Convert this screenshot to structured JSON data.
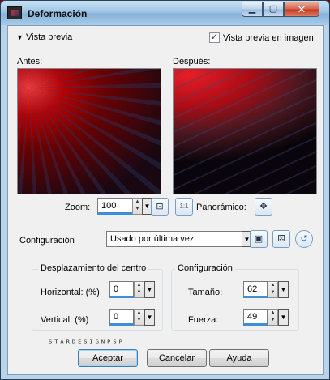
{
  "window": {
    "title": "Deformación",
    "controls": {
      "minimize": "▁",
      "maximize": "▢",
      "close": "✕"
    }
  },
  "preview_section": {
    "toggle_label": "Vista previa",
    "checkbox_label": "Vista previa en imagen",
    "checkbox_checked": true,
    "before_label": "Antes:",
    "after_label": "Después:"
  },
  "zoom": {
    "label": "Zoom:",
    "value": "100",
    "pan_label": "Panorámico:",
    "one_to_one": "1:1"
  },
  "configuracion_top": {
    "label": "Configuración",
    "selected_preset": "Usado por última vez"
  },
  "center_group": {
    "title": "Desplazamiento del centro",
    "horizontal_label": "Horizontal: (%)",
    "horizontal_value": "0",
    "vertical_label": "Vertical: (%)",
    "vertical_value": "0"
  },
  "config_group": {
    "title": "Configuración",
    "size_label": "Tamaño:",
    "size_value": "62",
    "strength_label": "Fuerza:",
    "strength_value": "49"
  },
  "watermark_text": "STARDESIGNPSP",
  "buttons": {
    "accept": "Aceptar",
    "cancel": "Cancelar",
    "help": "Ayuda"
  }
}
